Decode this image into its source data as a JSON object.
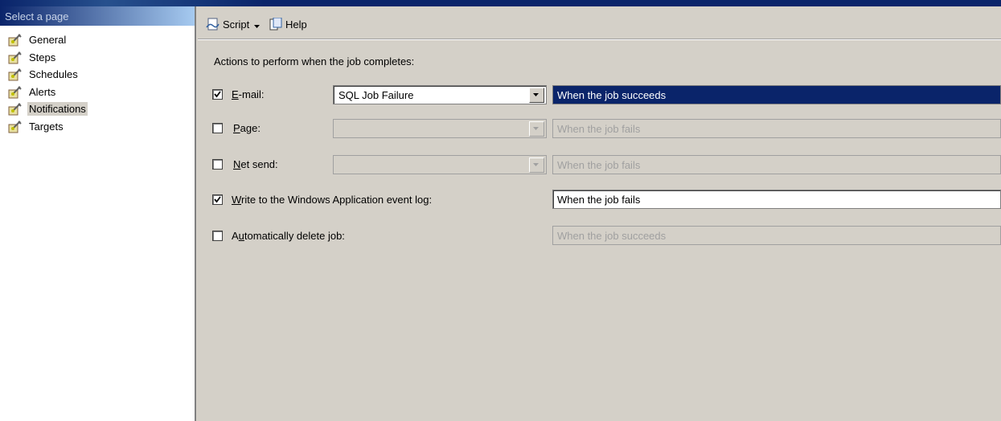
{
  "left_pane": {
    "header": "Select a page",
    "items": [
      {
        "label": "General"
      },
      {
        "label": "Steps"
      },
      {
        "label": "Schedules"
      },
      {
        "label": "Alerts"
      },
      {
        "label": "Notifications"
      },
      {
        "label": "Targets"
      }
    ],
    "selected": "Notifications",
    "icon": "wrench-page-icon"
  },
  "toolbar": {
    "script_label": "Script",
    "help_label": "Help"
  },
  "heading": "Actions to perform when the job completes:",
  "notifications": {
    "email": {
      "checked": true,
      "label_mnemonic": "E",
      "label_rest": "-mail:",
      "operator": "SQL Job Failure",
      "condition": "When the job succeeds",
      "condition_state": "selected"
    },
    "page": {
      "checked": false,
      "label_mnemonic": "P",
      "label_rest": "age:",
      "operator": "",
      "condition": "When the job fails",
      "condition_state": "disabled"
    },
    "net_send": {
      "checked": false,
      "label_mnemonic": "N",
      "label_rest": "et send:",
      "operator": "",
      "condition": "When the job fails",
      "condition_state": "disabled"
    },
    "event_log": {
      "checked": true,
      "label_mnemonic": "W",
      "label_rest": "rite to the Windows Application event log:",
      "condition": "When the job fails",
      "condition_state": "enabled"
    },
    "delete_job": {
      "checked": false,
      "label_prefix": "A",
      "label_mnemonic": "u",
      "label_rest": "tomatically delete job:",
      "condition": "When the job succeeds",
      "condition_state": "disabled"
    }
  },
  "colors": {
    "window_bg": "#d4d0c8",
    "selection": "#0a246a",
    "title_bar": "#0a246a"
  }
}
